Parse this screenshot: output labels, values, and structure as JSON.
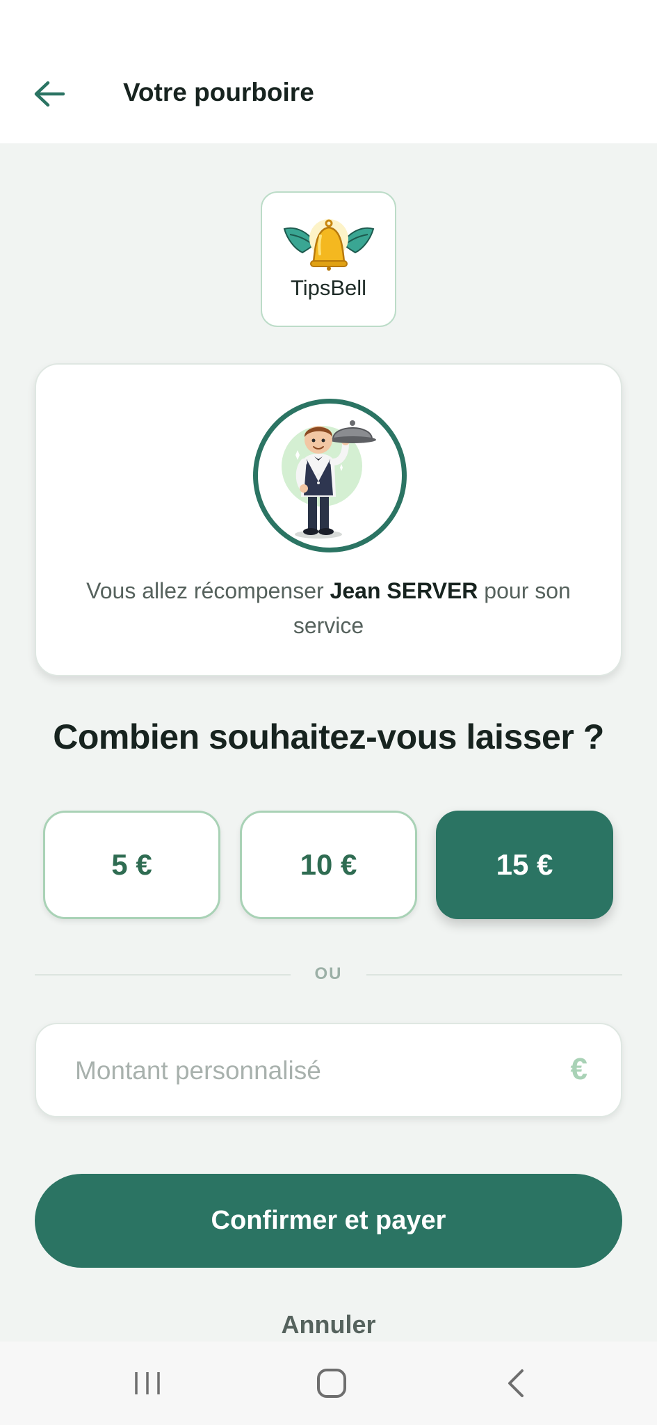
{
  "header": {
    "title": "Votre pourboire",
    "back_icon": "arrow-left-icon"
  },
  "logo": {
    "text": "TipsBell",
    "icon": "winged-bell-icon"
  },
  "recipient": {
    "text_before": "Vous allez récompenser ",
    "name": "Jean SERVER",
    "text_after": " pour son service",
    "avatar_icon": "waiter-avatar-icon"
  },
  "question": "Combien souhaitez-vous laisser ?",
  "amounts": [
    {
      "label": "5 €",
      "selected": false
    },
    {
      "label": "10 €",
      "selected": false
    },
    {
      "label": "15 €",
      "selected": true
    }
  ],
  "divider_text": "OU",
  "custom_amount": {
    "placeholder": "Montant personnalisé",
    "value": "",
    "suffix": "€"
  },
  "confirm_label": "Confirmer et payer",
  "cancel_label": "Annuler",
  "colors": {
    "primary": "#2b7463",
    "accent_light": "#a9d2b6",
    "background": "#f1f4f2"
  },
  "system_nav": [
    "recent-apps-icon",
    "home-icon",
    "back-icon"
  ]
}
